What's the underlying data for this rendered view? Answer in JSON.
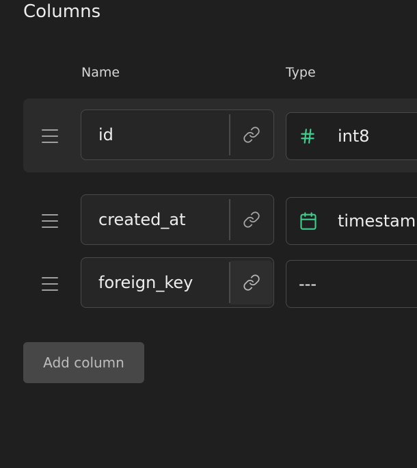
{
  "section": {
    "title": "Columns"
  },
  "headers": {
    "name": "Name",
    "type": "Type"
  },
  "columns": [
    {
      "name": "id",
      "type": "int8",
      "type_icon": "hash-icon",
      "link_active": false
    },
    {
      "name": "created_at",
      "type": "timestamp",
      "type_icon": "calendar-icon",
      "link_active": false
    },
    {
      "name": "foreign_key",
      "type": "---",
      "type_icon": "",
      "link_active": true
    }
  ],
  "actions": {
    "add_column": "Add column"
  },
  "colors": {
    "accent": "#3ecf8e",
    "background": "#1f1f1f",
    "row_highlight": "#2b2b2b",
    "border": "#4a4a4a"
  }
}
